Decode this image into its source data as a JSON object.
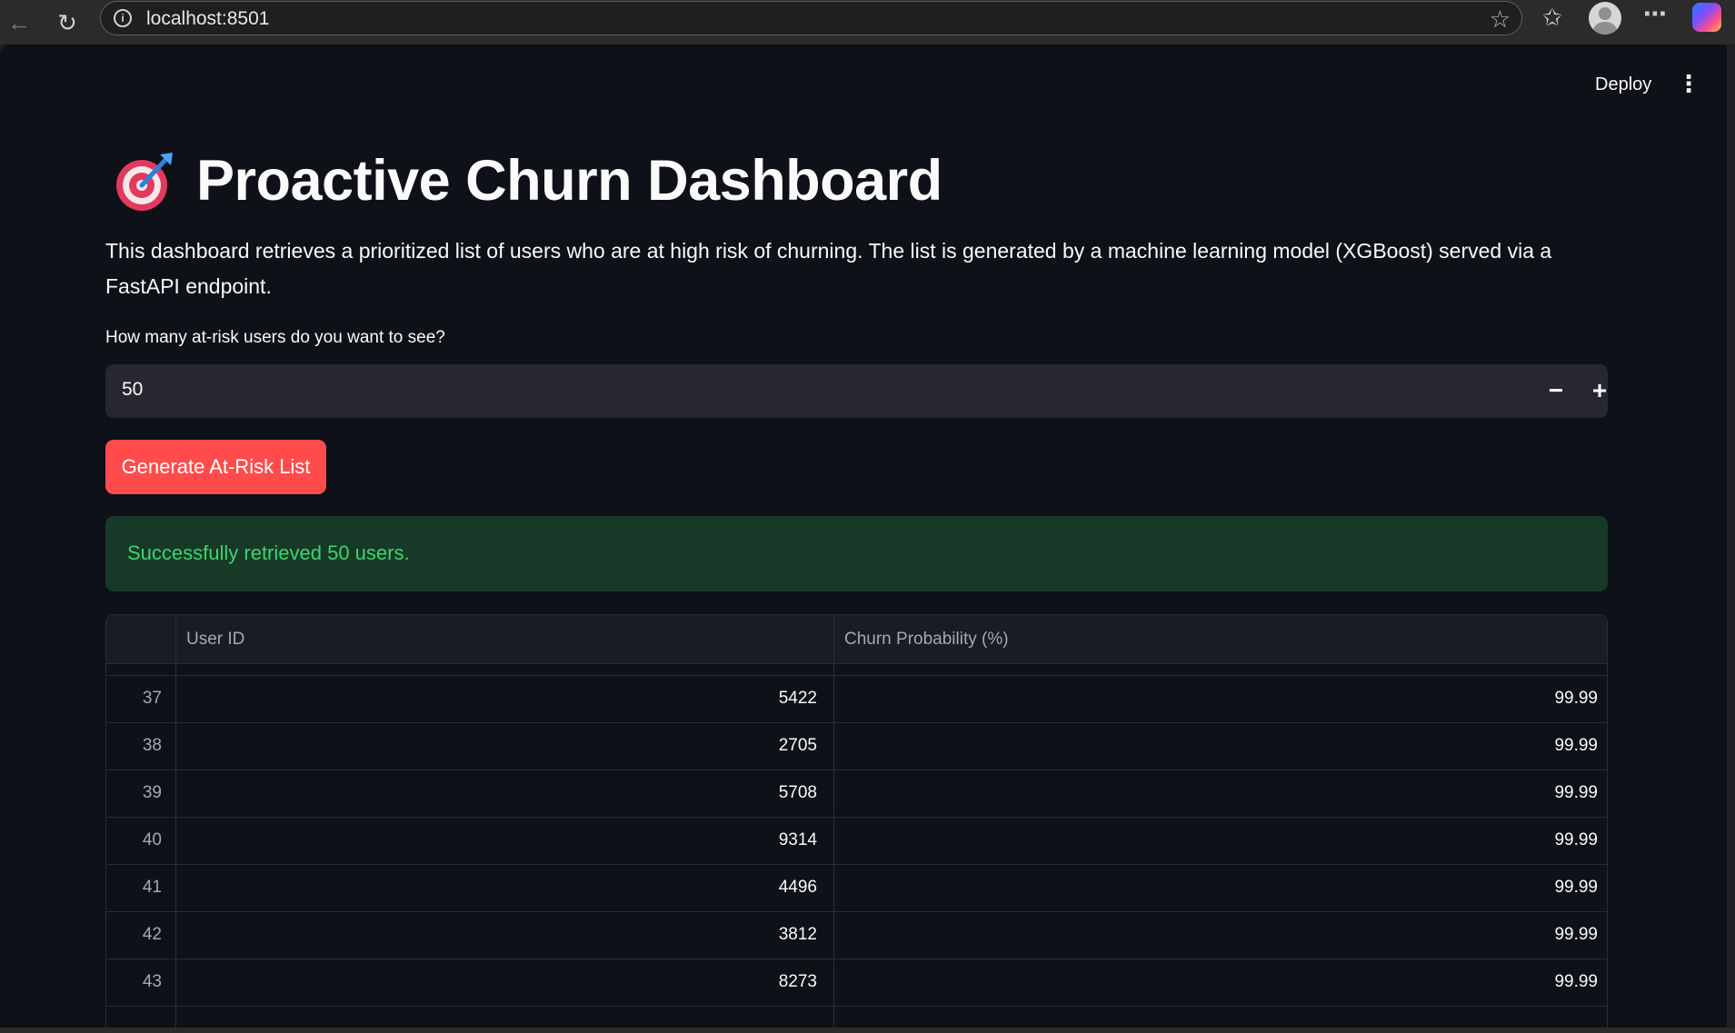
{
  "browser": {
    "url": "localhost:8501"
  },
  "header": {
    "deploy_label": "Deploy",
    "menu_icon": "kebab-menu-icon"
  },
  "main": {
    "title_icon": "direct-hit-target-icon",
    "title": "Proactive Churn Dashboard",
    "description": "This dashboard retrieves a prioritized list of users who are at high risk of churning. The list is generated by a machine learning model (XGBoost) served via a FastAPI endpoint.",
    "number_input": {
      "label": "How many at-risk users do you want to see?",
      "value": "50",
      "decrement": "−",
      "increment": "+"
    },
    "generate_button_label": "Generate At-Risk List",
    "success_message": "Successfully retrieved 50 users.",
    "table": {
      "columns": [
        "User ID",
        "Churn Probability (%)"
      ],
      "rows": [
        {
          "index": "37",
          "user_id": "5422",
          "probability": "99.99"
        },
        {
          "index": "38",
          "user_id": "2705",
          "probability": "99.99"
        },
        {
          "index": "39",
          "user_id": "5708",
          "probability": "99.99"
        },
        {
          "index": "40",
          "user_id": "9314",
          "probability": "99.99"
        },
        {
          "index": "41",
          "user_id": "4496",
          "probability": "99.99"
        },
        {
          "index": "42",
          "user_id": "3812",
          "probability": "99.99"
        },
        {
          "index": "43",
          "user_id": "8273",
          "probability": "99.99"
        }
      ]
    }
  },
  "colors": {
    "page_bg": "#0e1117",
    "primary_button": "#ff4b4b",
    "success_bg": "#173928",
    "success_text": "#3dd56d",
    "input_bg": "#262730"
  }
}
